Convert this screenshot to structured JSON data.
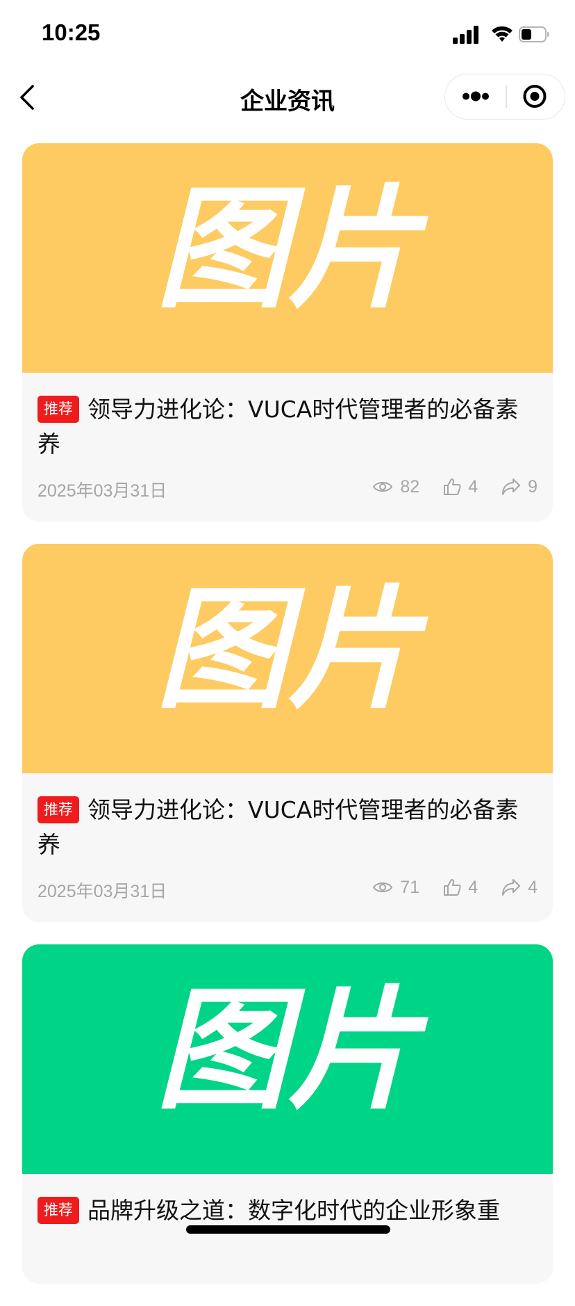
{
  "status_bar": {
    "time": "10:25",
    "icons": [
      "cellular-signal-icon",
      "wifi-icon",
      "battery-icon"
    ]
  },
  "nav": {
    "title": "企业资讯",
    "back_icon": "chevron-left-icon",
    "more_icon": "more-dots-icon",
    "close_icon": "target-close-icon"
  },
  "colors": {
    "badge": "#ee1c1c",
    "card_bg": "#f7f7f7",
    "meta_text": "#a6a6a6",
    "image_yellow": "#fecb62",
    "image_green": "#00d486"
  },
  "articles": [
    {
      "image_text": "图片",
      "image_color": "#fecb62",
      "badge": "推荐",
      "title": "领导力进化论：VUCA时代管理者的必备素养",
      "date": "2025年03月31日",
      "views": "82",
      "likes": "4",
      "shares": "9"
    },
    {
      "image_text": "图片",
      "image_color": "#fecb62",
      "badge": "推荐",
      "title": "领导力进化论：VUCA时代管理者的必备素养",
      "date": "2025年03月31日",
      "views": "71",
      "likes": "4",
      "shares": "4"
    },
    {
      "image_text": "图片",
      "image_color": "#00d486",
      "badge": "推荐",
      "title": "品牌升级之道：数字化时代的企业形象重"
    }
  ]
}
